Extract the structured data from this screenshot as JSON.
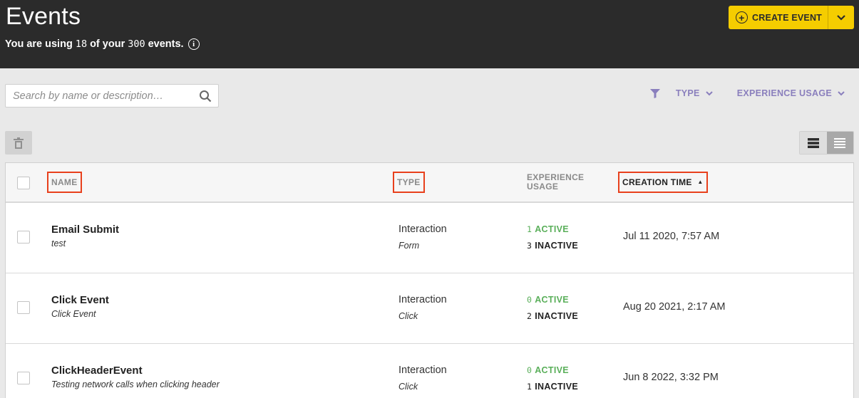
{
  "header": {
    "title": "Events",
    "usage_prefix": "You are using",
    "usage_used": "18",
    "usage_middle": "of your",
    "usage_total": "300",
    "usage_suffix": "events.",
    "info_icon": "info-circle-icon",
    "create_label": "CREATE EVENT",
    "create_icon": "plus-circle-icon",
    "create_menu_icon": "chevron-down-icon",
    "accent": "#f5cd00",
    "background": "#2b2b2b"
  },
  "toolbar": {
    "search_placeholder": "Search by name or description…",
    "search_icon": "magnifier-icon",
    "filter_icon": "funnel-icon",
    "filter_type_label": "TYPE",
    "filter_usage_label": "EXPERIENCE USAGE",
    "filter_color": "#8a7fbd",
    "delete_icon": "trash-icon",
    "view_modes": [
      "expanded-list-icon",
      "compact-list-icon"
    ],
    "active_view": "compact-list-icon"
  },
  "table": {
    "columns": {
      "name": "NAME",
      "type": "TYPE",
      "usage_line1": "EXPERIENCE",
      "usage_line2": "USAGE",
      "creation_time": "CREATION TIME",
      "sort_indicator": "▲"
    },
    "highlight_color": "#e8401c",
    "active_color": "#5aaf5a",
    "rows": [
      {
        "name": "Email Submit",
        "description": "test",
        "type": "Interaction",
        "subtype": "Form",
        "active_count": "1",
        "active_label": "ACTIVE",
        "inactive_count": "3",
        "inactive_label": "INACTIVE",
        "creation_time": "Jul 11 2020, 7:57 AM"
      },
      {
        "name": "Click Event",
        "description": "Click Event",
        "type": "Interaction",
        "subtype": "Click",
        "active_count": "0",
        "active_label": "ACTIVE",
        "inactive_count": "2",
        "inactive_label": "INACTIVE",
        "creation_time": "Aug 20 2021, 2:17 AM"
      },
      {
        "name": "ClickHeaderEvent",
        "description": "Testing network calls when clicking header",
        "type": "Interaction",
        "subtype": "Click",
        "active_count": "0",
        "active_label": "ACTIVE",
        "inactive_count": "1",
        "inactive_label": "INACTIVE",
        "creation_time": "Jun 8 2022, 3:32 PM"
      }
    ]
  }
}
